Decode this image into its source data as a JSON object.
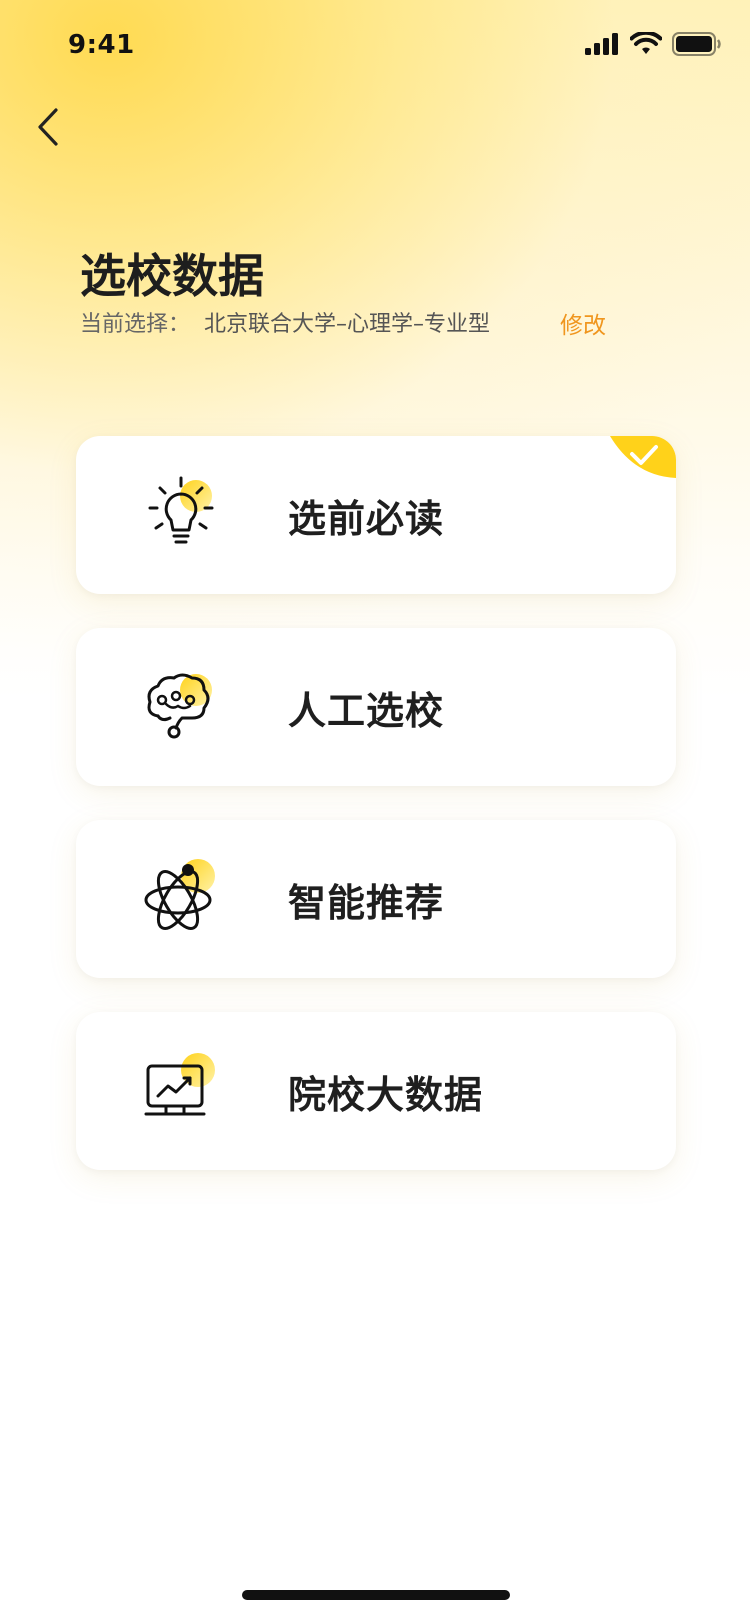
{
  "status": {
    "time": "9:41"
  },
  "header": {
    "title": "选校数据",
    "current_label": "当前选择：",
    "current_value": "北京联合大学–心理学–专业型",
    "edit_label": "修改"
  },
  "menu": [
    {
      "label": "选前必读",
      "icon": "lightbulb-icon",
      "checked": true
    },
    {
      "label": "人工选校",
      "icon": "brain-icon",
      "checked": false
    },
    {
      "label": "智能推荐",
      "icon": "atom-icon",
      "checked": false
    },
    {
      "label": "院校大数据",
      "icon": "chart-monitor-icon",
      "checked": false
    }
  ],
  "colors": {
    "accent": "#f0961e",
    "highlight": "#ffd21a",
    "text": "#1f1f1f"
  }
}
